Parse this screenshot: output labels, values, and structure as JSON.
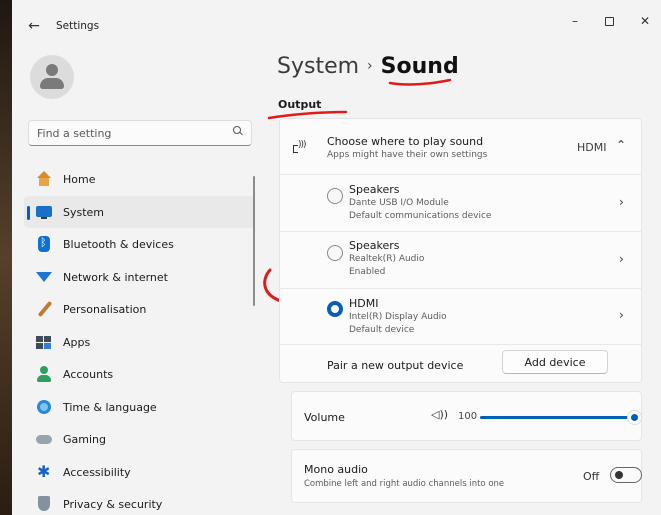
{
  "window": {
    "app_title": "Settings",
    "minimize": "–",
    "maximize": "",
    "close": "✕"
  },
  "sidebar": {
    "search_placeholder": "Find a setting",
    "items": [
      {
        "label": "Home",
        "icon": "home-icon"
      },
      {
        "label": "System",
        "icon": "system-icon",
        "active": true
      },
      {
        "label": "Bluetooth & devices",
        "icon": "bluetooth-icon"
      },
      {
        "label": "Network & internet",
        "icon": "network-icon"
      },
      {
        "label": "Personalisation",
        "icon": "personalisation-icon"
      },
      {
        "label": "Apps",
        "icon": "apps-icon"
      },
      {
        "label": "Accounts",
        "icon": "accounts-icon"
      },
      {
        "label": "Time & language",
        "icon": "time-language-icon"
      },
      {
        "label": "Gaming",
        "icon": "gaming-icon"
      },
      {
        "label": "Accessibility",
        "icon": "accessibility-icon"
      },
      {
        "label": "Privacy & security",
        "icon": "privacy-icon"
      }
    ]
  },
  "header": {
    "breadcrumb_parent": "System",
    "breadcrumb_separator": "›",
    "breadcrumb_current": "Sound"
  },
  "output": {
    "section_title": "Output",
    "choose_title": "Choose where to play sound",
    "choose_sub": "Apps might have their own settings",
    "current_device": "HDMI",
    "devices": [
      {
        "name": "Speakers",
        "line1": "Dante USB I/O Module",
        "line2": "Default communications device",
        "selected": false
      },
      {
        "name": "Speakers",
        "line1": "Realtek(R) Audio",
        "line2": "Enabled",
        "selected": false
      },
      {
        "name": "HDMI",
        "line1": "Intel(R) Display Audio",
        "line2": "Default device",
        "selected": true
      }
    ],
    "pair_label": "Pair a new output device",
    "add_device_button": "Add device"
  },
  "volume": {
    "label": "Volume",
    "value": "100"
  },
  "mono": {
    "title": "Mono audio",
    "sub": "Combine left and right audio channels into one",
    "state": "Off"
  },
  "colors": {
    "accent": "#005fb8",
    "annotation": "#e01b1b"
  }
}
